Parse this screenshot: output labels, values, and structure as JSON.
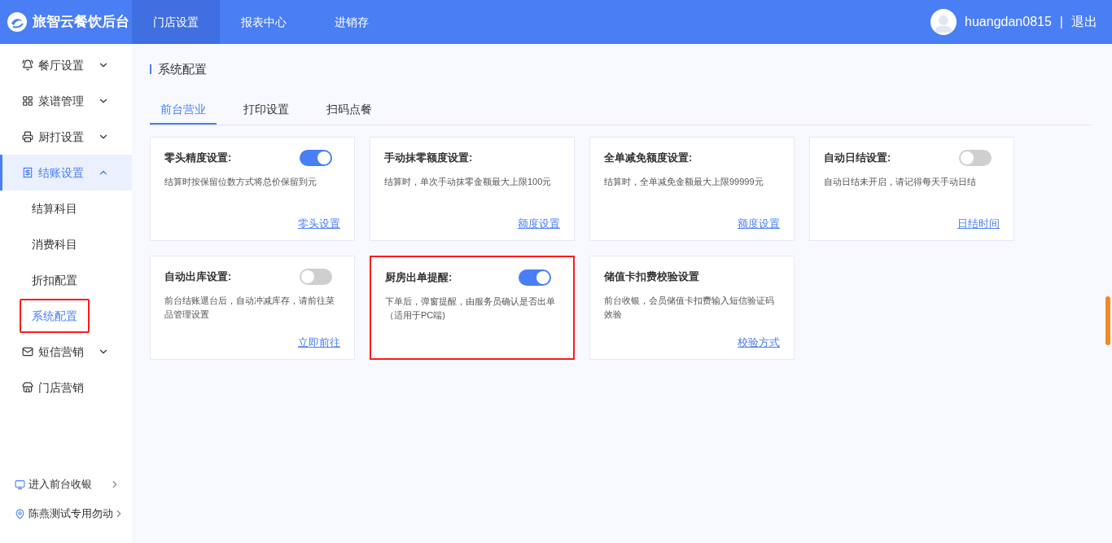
{
  "header": {
    "logo_text": "旅智云餐饮后台",
    "nav": [
      {
        "label": "门店设置",
        "selected": true
      },
      {
        "label": "报表中心",
        "selected": false
      },
      {
        "label": "进销存",
        "selected": false
      }
    ],
    "user": {
      "name": "huangdan0815",
      "separator": "|",
      "logout": "退出"
    }
  },
  "sidebar": {
    "items": [
      {
        "label": "餐厅设置",
        "expanded": false,
        "selected": false
      },
      {
        "label": "菜谱管理",
        "expanded": false,
        "selected": false
      },
      {
        "label": "厨打设置",
        "expanded": false,
        "selected": false
      },
      {
        "label": "结账设置",
        "expanded": true,
        "selected": true,
        "children": [
          {
            "label": "结算科目",
            "selected": false,
            "highlighted": false
          },
          {
            "label": "消费科目",
            "selected": false,
            "highlighted": false
          },
          {
            "label": "折扣配置",
            "selected": false,
            "highlighted": false
          },
          {
            "label": "系统配置",
            "selected": true,
            "highlighted": true
          }
        ]
      },
      {
        "label": "短信营销",
        "expanded": false,
        "selected": false
      },
      {
        "label": "门店营销",
        "selected": false
      }
    ],
    "footer_links": [
      {
        "label": "进入前台收银"
      },
      {
        "label": "陈燕测试专用勿动"
      }
    ]
  },
  "page": {
    "title": "系统配置",
    "tabs": [
      {
        "label": "前台营业",
        "selected": true
      },
      {
        "label": "打印设置",
        "selected": false
      },
      {
        "label": "扫码点餐",
        "selected": false
      }
    ],
    "cards": [
      {
        "title": "零头精度设置:",
        "toggle": {
          "on": true
        },
        "description": "结算时按保留位数方式将总价保留到元",
        "link": "零头设置",
        "highlighted": false
      },
      {
        "title": "手动抹零额度设置:",
        "description": "结算时，单次手动抹零金额最大上限100元",
        "link": "额度设置",
        "highlighted": false
      },
      {
        "title": "全单减免额度设置:",
        "description": "结算时，全单减免金额最大上限99999元",
        "link": "额度设置",
        "highlighted": false
      },
      {
        "title": "自动日结设置:",
        "toggle": {
          "on": false
        },
        "description": "自动日结未开启，请记得每天手动日结",
        "link": "日结时间",
        "highlighted": false
      },
      {
        "title": "自动出库设置:",
        "toggle": {
          "on": false
        },
        "description": "前台结账退台后，自动冲减库存，请前往菜品管理设置",
        "link": "立即前往",
        "highlighted": false
      },
      {
        "title": "厨房出单提醒:",
        "toggle": {
          "on": true
        },
        "description": "下单后，弹窗提醒，由服务员确认是否出单（适用于PC端)",
        "highlighted": true
      },
      {
        "title": "储值卡扣费校验设置",
        "description": "前台收银，会员储值卡扣费输入短信验证码效验",
        "link": "校验方式",
        "highlighted": false
      }
    ]
  }
}
